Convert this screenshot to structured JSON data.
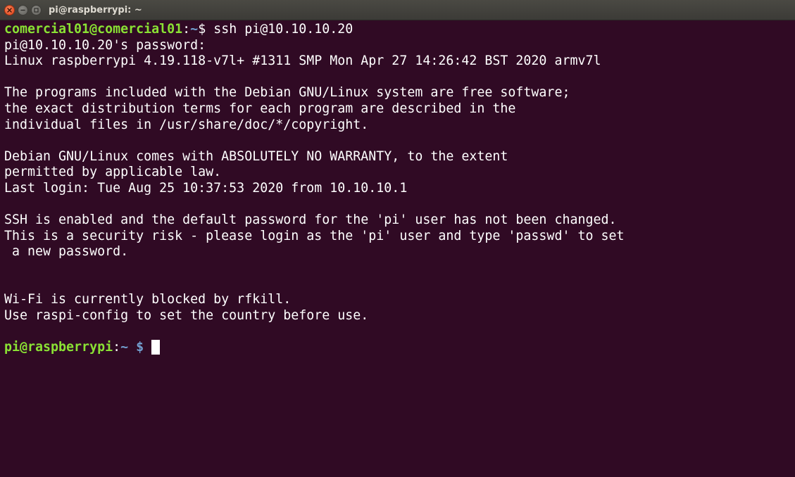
{
  "window": {
    "title": "pi@raspberrypi: ~"
  },
  "colors": {
    "background": "#300a24",
    "text": "#ffffff",
    "prompt_host": "#8ae234",
    "prompt_path": "#729fcf",
    "close_button": "#e95420"
  },
  "terminal": {
    "first_prompt": {
      "user_host": "comercial01@comercial01",
      "sep": ":",
      "path": "~",
      "symbol": "$ ",
      "command": "ssh pi@10.10.10.20"
    },
    "lines": [
      "pi@10.10.10.20's password:",
      "Linux raspberrypi 4.19.118-v7l+ #1311 SMP Mon Apr 27 14:26:42 BST 2020 armv7l",
      "",
      "The programs included with the Debian GNU/Linux system are free software;",
      "the exact distribution terms for each program are described in the",
      "individual files in /usr/share/doc/*/copyright.",
      "",
      "Debian GNU/Linux comes with ABSOLUTELY NO WARRANTY, to the extent",
      "permitted by applicable law.",
      "Last login: Tue Aug 25 10:37:53 2020 from 10.10.10.1",
      "",
      "SSH is enabled and the default password for the 'pi' user has not been changed.",
      "This is a security risk - please login as the 'pi' user and type 'passwd' to set",
      " a new password.",
      "",
      "",
      "Wi-Fi is currently blocked by rfkill.",
      "Use raspi-config to set the country before use.",
      ""
    ],
    "final_prompt": {
      "user_host": "pi@raspberrypi",
      "sep": ":",
      "path": "~ $",
      "after": " "
    }
  }
}
